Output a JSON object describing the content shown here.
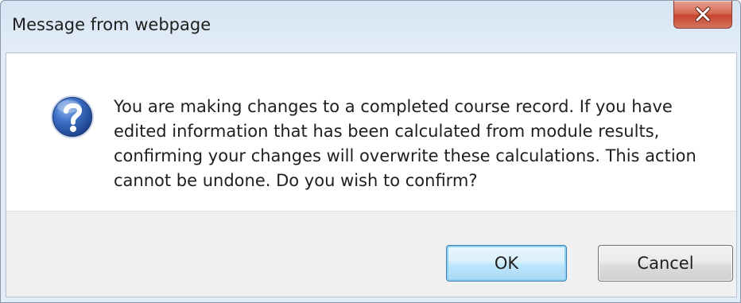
{
  "dialog": {
    "title": "Message from webpage",
    "icon": "question-icon",
    "message": "You are making changes to a completed course record. If you have edited information that has been calculated from module results, confirming your changes will overwrite these calculations. This action cannot be undone. Do you wish to confirm?",
    "ok_label": "OK",
    "cancel_label": "Cancel"
  },
  "colors": {
    "close_button": "#d86b55",
    "ok_border": "#3c7fb1",
    "question_icon": "#2c5aa8"
  }
}
